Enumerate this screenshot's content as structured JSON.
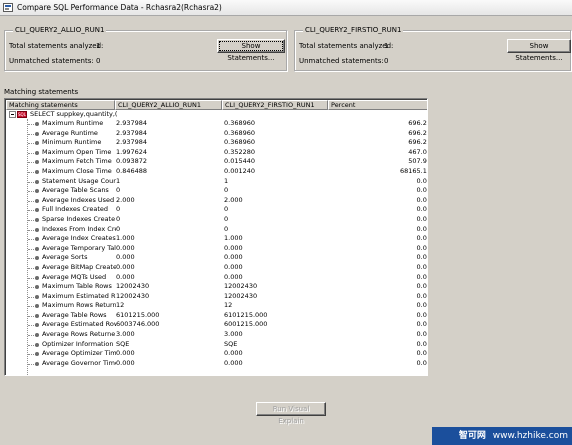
{
  "window": {
    "title": "Compare SQL Performance Data - Rchasra2(Rchasra2)"
  },
  "left_group": {
    "title": "CLI_QUERY2_ALLIO_RUN1",
    "total_label": "Total statements analyzed:",
    "total_value": "1",
    "unmatched_label": "Unmatched statements:",
    "unmatched_value": "0",
    "button_label": "Show Statements..."
  },
  "right_group": {
    "title": "CLI_QUERY2_FIRSTIO_RUN1",
    "total_label": "Total statements analyzed:",
    "total_value": "1",
    "unmatched_label": "Unmatched statements:",
    "unmatched_value": "0",
    "button_label": "Show Statements..."
  },
  "matching": {
    "section_label": "Matching statements",
    "columns": [
      "Matching statements",
      "CLI_QUERY2_ALLIO_RUN1",
      "CLI_QUERY2_FIRSTIO_RUN1",
      "Percent"
    ],
    "root_statement": "SELECT suppkey,quantity,(",
    "rows": [
      {
        "name": "Maximum Runtime",
        "v1": "2.937984",
        "v2": "0.368960",
        "pct": "696.28"
      },
      {
        "name": "Average Runtime",
        "v1": "2.937984",
        "v2": "0.368960",
        "pct": "696.28"
      },
      {
        "name": "Minimum Runtime",
        "v1": "2.937984",
        "v2": "0.368960",
        "pct": "696.28"
      },
      {
        "name": "Maximum Open Time",
        "v1": "1.997624",
        "v2": "0.352280",
        "pct": "467.05"
      },
      {
        "name": "Maximum Fetch Time",
        "v1": "0.093872",
        "v2": "0.015440",
        "pct": "507.97"
      },
      {
        "name": "Maximum Close Time",
        "v1": "0.846488",
        "v2": "0.001240",
        "pct": "68165.16"
      },
      {
        "name": "Statement Usage Cour",
        "v1": "1",
        "v2": "1",
        "pct": "0.00"
      },
      {
        "name": "Average Table Scans",
        "v1": "0",
        "v2": "0",
        "pct": "0.00"
      },
      {
        "name": "Average Indexes Used",
        "v1": "2.000",
        "v2": "2.000",
        "pct": "0.00"
      },
      {
        "name": "Full Indexes Created",
        "v1": "0",
        "v2": "0",
        "pct": "0.00"
      },
      {
        "name": "Sparse Indexes Create",
        "v1": "0",
        "v2": "0",
        "pct": "0.00"
      },
      {
        "name": "Indexes From Index Cre",
        "v1": "0",
        "v2": "0",
        "pct": "0.00"
      },
      {
        "name": "Average Index Creates",
        "v1": "1.000",
        "v2": "1.000",
        "pct": "0.00"
      },
      {
        "name": "Average Temporary Tal",
        "v1": "0.000",
        "v2": "0.000",
        "pct": "0.00"
      },
      {
        "name": "Average Sorts",
        "v1": "0.000",
        "v2": "0.000",
        "pct": "0.00"
      },
      {
        "name": "Average BitMap Create:",
        "v1": "0.000",
        "v2": "0.000",
        "pct": "0.00"
      },
      {
        "name": "Average MQTs Used",
        "v1": "0.000",
        "v2": "0.000",
        "pct": "0.00"
      },
      {
        "name": "Maximum Table Rows",
        "v1": "12002430",
        "v2": "12002430",
        "pct": "0.00"
      },
      {
        "name": "Maximum Estimated R",
        "v1": "12002430",
        "v2": "12002430",
        "pct": "0.00"
      },
      {
        "name": "Maximum Rows Return",
        "v1": "12",
        "v2": "12",
        "pct": "0.00"
      },
      {
        "name": "Average Table Rows",
        "v1": "6101215.000",
        "v2": "6101215.000",
        "pct": "0.00"
      },
      {
        "name": "Average Estimated Row",
        "v1": "6003746.000",
        "v2": "6001215.000",
        "pct": "0.04"
      },
      {
        "name": "Average Rows Returne",
        "v1": "3.000",
        "v2": "3.000",
        "pct": "0.00"
      },
      {
        "name": "Optimizer Information",
        "v1": "SQE",
        "v2": "SQE",
        "pct": "0.00"
      },
      {
        "name": "Average Optimizer Tim",
        "v1": "0.000",
        "v2": "0.000",
        "pct": "0.00"
      },
      {
        "name": "Average Governor Time",
        "v1": "0.000",
        "v2": "0.000",
        "pct": "0.00"
      }
    ]
  },
  "footer": {
    "run_visual_explain_label": "Run Visual Explain"
  },
  "watermark": {
    "cn": "智可网",
    "url": "www.hzhike.com"
  }
}
